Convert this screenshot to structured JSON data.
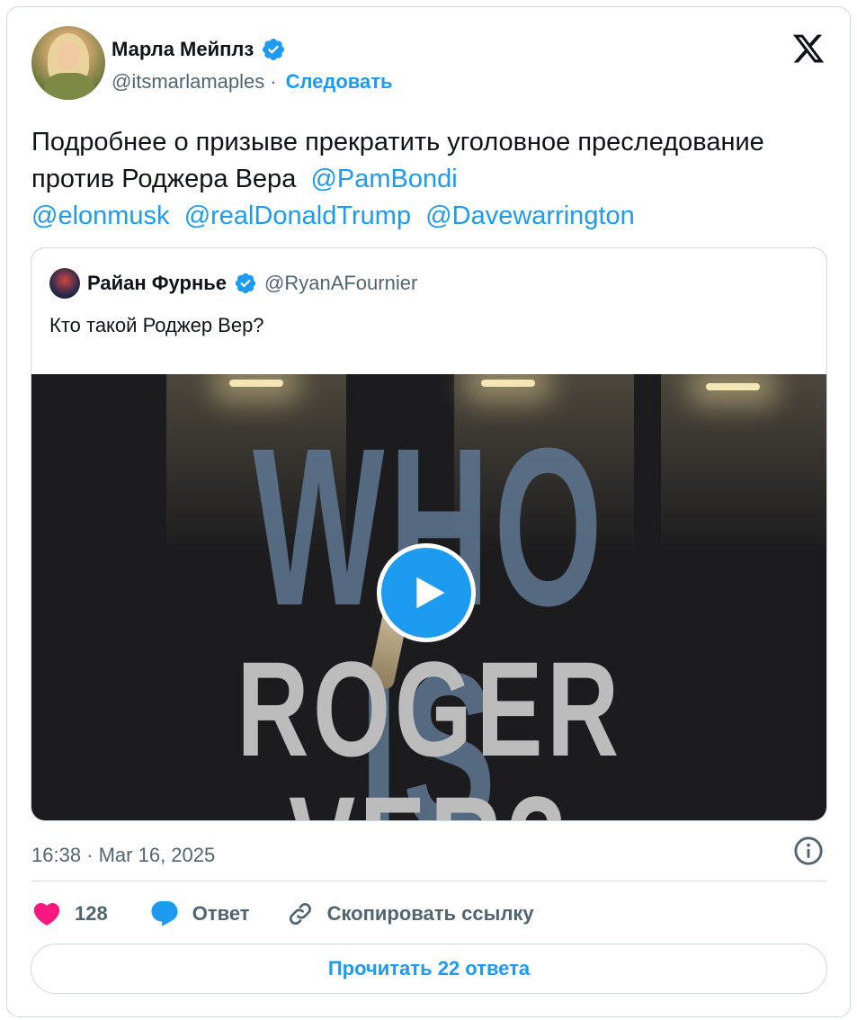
{
  "author": {
    "name": "Марла Мейплз",
    "handle": "@itsmarlamaples",
    "separator": "·",
    "follow_label": "Следовать"
  },
  "tweet": {
    "text": "Подробнее о призыве прекратить уголовное преследование против Роджера Вера",
    "mentions": [
      "@PamBondi",
      "@elonmusk",
      "@realDonaldTrump",
      "@Davewarrington"
    ]
  },
  "quote": {
    "name": "Райан Фурнье",
    "handle": "@RyanAFournier",
    "text": "Кто такой Роджер Вер?",
    "video": {
      "title_line1": "WHO IS",
      "title_line2": "ROGER VER?"
    }
  },
  "meta": {
    "timestamp": "16:38 · Mar 16, 2025"
  },
  "actions": {
    "likes": "128",
    "reply_label": "Ответ",
    "copy_link_label": "Скопировать ссылку"
  },
  "read_replies_label": "Прочитать 22 ответа",
  "colors": {
    "accent": "#1d9bf0",
    "like": "#f91880",
    "text": "#0f1419",
    "secondary": "#536471",
    "border": "#cfd9de"
  }
}
